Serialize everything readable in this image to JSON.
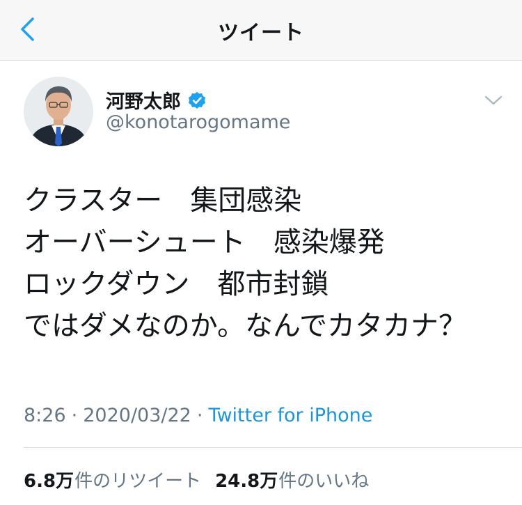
{
  "header": {
    "title": "ツイート",
    "back_icon": "chevron-left-icon"
  },
  "author": {
    "name": "河野太郎",
    "handle": "@konotarogomame",
    "verified": true,
    "verified_color": "#1da1f2"
  },
  "tweet": {
    "lines": [
      "クラスター　集団感染",
      "オーバーシュート　感染爆発",
      "ロックダウン　都市封鎖",
      "ではダメなのか。なんでカタカナ？"
    ],
    "time": "8:26",
    "separator": "·",
    "date": "2020/03/22",
    "source": "Twitter for iPhone"
  },
  "stats": {
    "retweets_count": "6.8万",
    "retweets_label": "件のリツイート",
    "likes_count": "24.8万",
    "likes_label": "件のいいね"
  },
  "colors": {
    "link": "#1b95e0",
    "secondary_text": "#657786",
    "header_bg": "#f7f7f7",
    "accent": "#1da1f2"
  }
}
